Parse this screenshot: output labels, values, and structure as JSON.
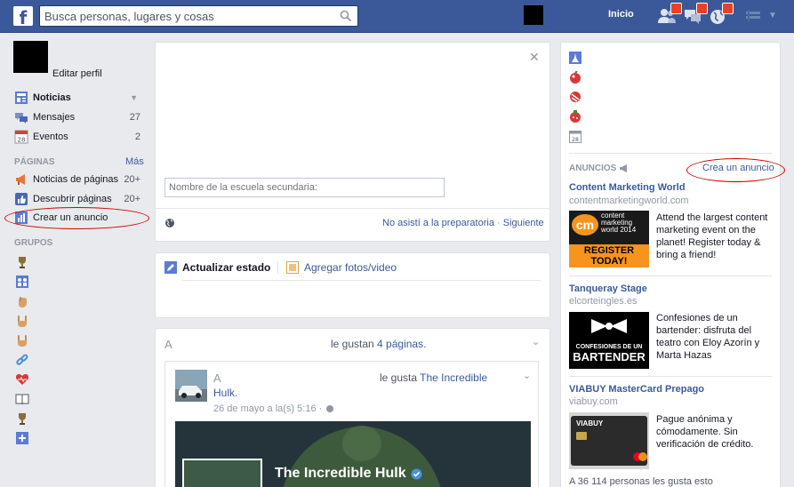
{
  "topbar": {
    "logo": "f",
    "search_placeholder": "Busca personas, lugares y cosas",
    "home_label": "Inicio"
  },
  "left_nav": {
    "edit_profile": "Editar perfil",
    "favorites": [
      {
        "label": "Noticias",
        "count": "",
        "icon": "newsfeed-icon"
      },
      {
        "label": "Mensajes",
        "count": "27",
        "icon": "messages-icon"
      },
      {
        "label": "Eventos",
        "count": "2",
        "icon": "calendar-icon"
      }
    ],
    "pages_header": "PÁGINAS",
    "pages_more": "Más",
    "pages": [
      {
        "label": "Noticias de páginas",
        "count": "20+"
      },
      {
        "label": "Descubrir páginas",
        "count": "20+"
      },
      {
        "label": "Crear un anuncio",
        "count": ""
      }
    ],
    "groups_header": "GRUPOS",
    "group_icons": [
      "trophy-icon",
      "group-icon",
      "hand-icon",
      "rock-hand-icon",
      "rock-hand-icon",
      "link-icon",
      "heart-icon",
      "book-icon",
      "trophy-icon",
      "plus-icon"
    ]
  },
  "center": {
    "school_placeholder": "Nombre de la escuela secundaria:",
    "footer_skip": "No asistí a la preparatoria",
    "footer_sep": "·",
    "footer_next": "Siguiente",
    "composer_status": "Actualizar estado",
    "composer_photo": "Agregar fotos/video",
    "story_actor": "A",
    "story_like_prefix": "le gustan",
    "story_like_link": "4 páginas.",
    "post_actor": "A",
    "post_like_prefix": "le gusta",
    "post_like_link_1": "The Incredible",
    "post_like_link_2": "Hulk.",
    "post_time": "26 de mayo a la(s) 5:16 ·",
    "hero_title": "The Incredible Hulk"
  },
  "right": {
    "ads_header": "ANUNCIOS",
    "create_ad": "Crea un anuncio",
    "ads": [
      {
        "title": "Content Marketing World",
        "url": "contentmarketingworld.com",
        "text": "Attend the largest content marketing event on the planet! Register today & bring a friend!",
        "img_line1": "content",
        "img_line2": "marketing",
        "img_line3": "world 2014",
        "img_line4": "REGISTER",
        "img_line5": "TODAY!"
      },
      {
        "title": "Tanqueray Stage",
        "url": "elcorteingles.es",
        "text": "Confesiones de un bartender: disfruta del teatro con Eloy Azorín y Marta Hazas",
        "img_line1": "CONFESIONES DE UN",
        "img_line2": "BARTENDER"
      },
      {
        "title": "VIABUY MasterCard Prepago",
        "url": "viabuy.com",
        "text": "Pague anónima y cómodamente. Sin verificación de crédito.",
        "img_line1": "VIABUY"
      }
    ],
    "likes_footer": "A 36 114 personas les gusta esto"
  },
  "colors": {
    "brand": "#3b5998",
    "badge": "#f03d25",
    "annotation": "#cc0000"
  }
}
